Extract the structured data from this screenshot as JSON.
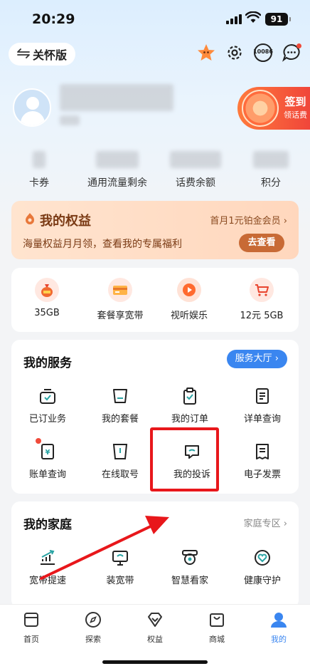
{
  "status_bar": {
    "time": "20:29",
    "battery": "91"
  },
  "header": {
    "care_mode_label": "关怀版",
    "icon_names": [
      "star-mascot-icon",
      "gear-icon",
      "support-10086-icon",
      "message-icon"
    ],
    "support_label": "10086"
  },
  "sign_in": {
    "title": "签到",
    "subtitle": "领话费"
  },
  "stats": [
    {
      "label": "卡券"
    },
    {
      "label": "通用流量剩余"
    },
    {
      "label": "话费余额"
    },
    {
      "label": "积分"
    }
  ],
  "rights": {
    "title": "我的权益",
    "promo": "首月1元铂金会员",
    "desc": "海量权益月月领，查看我的专属福利",
    "cta": "去查看"
  },
  "promo_items": [
    {
      "label": "35GB",
      "icon": "money-bag-icon"
    },
    {
      "label": "套餐享宽带",
      "icon": "card-icon"
    },
    {
      "label": "视听娱乐",
      "icon": "play-icon"
    },
    {
      "label": "12元 5GB",
      "icon": "cart-icon"
    }
  ],
  "services": {
    "title": "我的服务",
    "hall_label": "服务大厅",
    "items": [
      {
        "label": "已订业务",
        "icon": "subscribed-icon"
      },
      {
        "label": "我的套餐",
        "icon": "package-icon"
      },
      {
        "label": "我的订单",
        "icon": "order-icon"
      },
      {
        "label": "详单查询",
        "icon": "detail-list-icon"
      },
      {
        "label": "账单查询",
        "icon": "bill-icon"
      },
      {
        "label": "在线取号",
        "icon": "queue-number-icon"
      },
      {
        "label": "我的投诉",
        "icon": "complaint-icon"
      },
      {
        "label": "电子发票",
        "icon": "invoice-icon"
      }
    ]
  },
  "family": {
    "title": "我的家庭",
    "link": "家庭专区",
    "items": [
      {
        "label": "宽带提速",
        "icon": "speed-up-icon"
      },
      {
        "label": "装宽带",
        "icon": "monitor-icon"
      },
      {
        "label": "智慧看家",
        "icon": "camera-icon"
      },
      {
        "label": "健康守护",
        "icon": "health-icon"
      }
    ]
  },
  "tabbar": [
    {
      "label": "首页",
      "icon": "home-icon"
    },
    {
      "label": "探索",
      "icon": "compass-icon"
    },
    {
      "label": "权益",
      "icon": "diamond-icon"
    },
    {
      "label": "商城",
      "icon": "shop-bag-icon"
    },
    {
      "label": "我的",
      "icon": "profile-icon"
    }
  ],
  "colors": {
    "accent": "#3a86f0",
    "highlight": "#e8171b",
    "rights_cta": "#c86a35"
  }
}
